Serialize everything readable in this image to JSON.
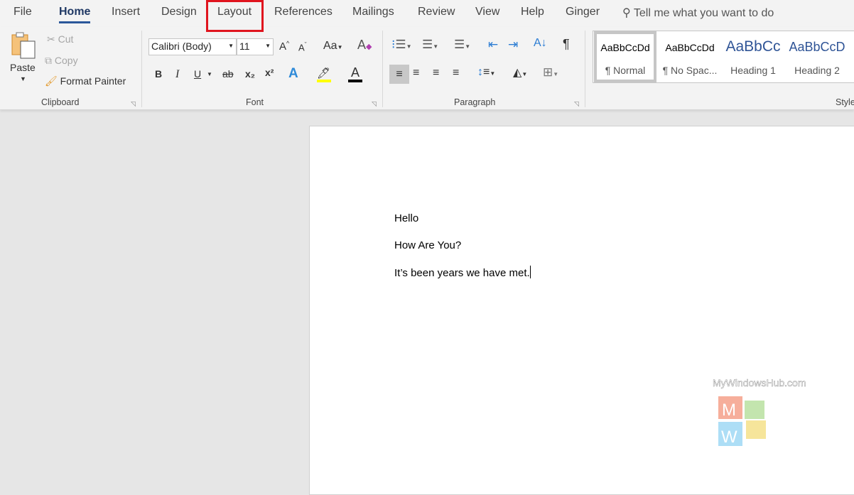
{
  "tabs": [
    {
      "label": "File"
    },
    {
      "label": "Home",
      "active": true
    },
    {
      "label": "Insert"
    },
    {
      "label": "Design"
    },
    {
      "label": "Layout",
      "highlighted": true
    },
    {
      "label": "References"
    },
    {
      "label": "Mailings"
    },
    {
      "label": "Review"
    },
    {
      "label": "View"
    },
    {
      "label": "Help"
    },
    {
      "label": "Ginger"
    }
  ],
  "tell_me": "Tell me what you want to do",
  "clipboard": {
    "paste": "Paste",
    "cut": "Cut",
    "copy": "Copy",
    "format_painter": "Format Painter",
    "label": "Clipboard"
  },
  "font": {
    "name": "Calibri (Body)",
    "size": "11",
    "case": "Aa",
    "label": "Font",
    "bold": "B",
    "italic": "I",
    "underline": "U",
    "strike": "ab",
    "sub": "x₂",
    "sup": "x²"
  },
  "paragraph": {
    "label": "Paragraph",
    "pilcrow": "¶"
  },
  "styles": {
    "label": "Styles",
    "items": [
      {
        "preview": "AaBbCcDd",
        "name": "¶ Normal"
      },
      {
        "preview": "AaBbCcDd",
        "name": "¶ No Spac..."
      },
      {
        "preview": "AaBbCc",
        "name": "Heading 1"
      },
      {
        "preview": "AaBbCcD",
        "name": "Heading 2"
      }
    ]
  },
  "document": {
    "lines": [
      "Hello",
      "How Are You?",
      "It’s been years we have met."
    ]
  },
  "watermark": "MyWindowsHub.com",
  "colors": {
    "accent": "#2b579a",
    "highlight_box": "#e0141e",
    "heading": "#2f5496"
  }
}
